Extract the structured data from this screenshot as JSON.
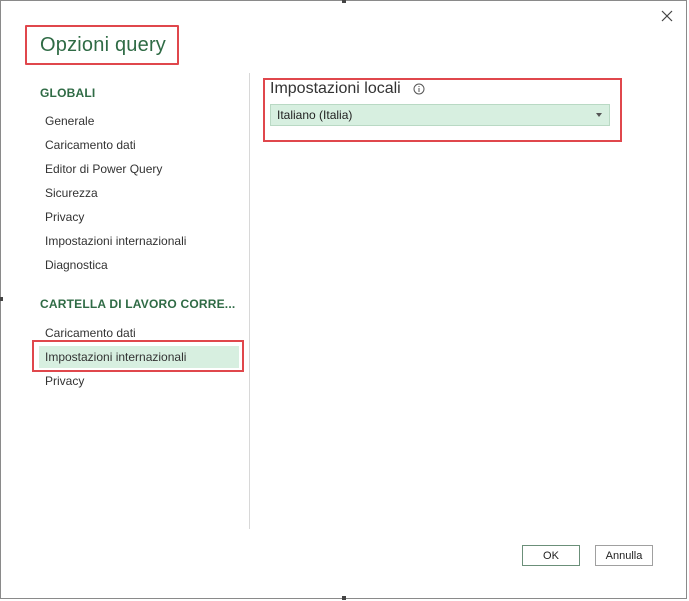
{
  "dialog": {
    "title": "Opzioni query",
    "close_icon": "close-icon"
  },
  "nav": {
    "global_header": "GLOBALI",
    "global_items": [
      {
        "label": "Generale"
      },
      {
        "label": "Caricamento dati"
      },
      {
        "label": "Editor di Power Query"
      },
      {
        "label": "Sicurezza"
      },
      {
        "label": "Privacy"
      },
      {
        "label": "Impostazioni internazionali"
      },
      {
        "label": "Diagnostica"
      }
    ],
    "workbook_header": "CARTELLA DI LAVORO CORRE...",
    "workbook_items": [
      {
        "label": "Caricamento dati"
      },
      {
        "label": "Impostazioni internazionali",
        "selected": true
      },
      {
        "label": "Privacy"
      }
    ]
  },
  "content": {
    "locale_label": "Impostazioni locali",
    "info_icon": "info-icon",
    "locale_value": "Italiano (Italia)"
  },
  "buttons": {
    "ok": "OK",
    "cancel": "Annulla"
  },
  "colors": {
    "accent_green": "#2f6b45",
    "selection_bg": "#d7efe0",
    "annotation_red": "#e0474c"
  }
}
